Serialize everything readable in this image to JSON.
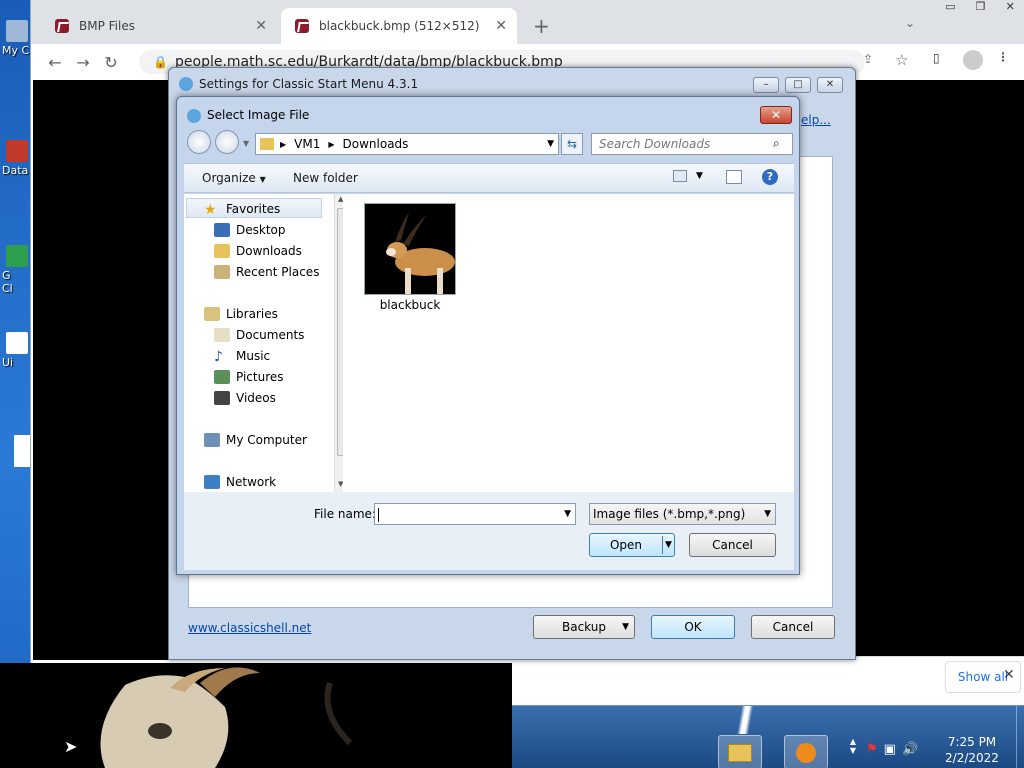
{
  "desktop": {
    "icons": [
      {
        "label": "My C"
      },
      {
        "label": "Data"
      },
      {
        "label": "G"
      },
      {
        "label": "Cl"
      },
      {
        "label": "Ui"
      }
    ]
  },
  "browser": {
    "tabs": [
      {
        "title": "BMP Files"
      },
      {
        "title": "blackbuck.bmp (512×512)"
      }
    ],
    "new_tab": "+",
    "url": "people.math.sc.edu/Burkardt/data/bmp/blackbuck.bmp",
    "help_link": "elp...",
    "download_bar": {
      "show_all": "Show all",
      "close": "✕"
    }
  },
  "classic_window": {
    "title": "Settings for Classic Start Menu 4.3.1",
    "link": "www.classicshell.net",
    "buttons": {
      "backup": "Backup",
      "ok": "OK",
      "cancel": "Cancel"
    }
  },
  "dialog": {
    "title": "Select Image File",
    "breadcrumb": [
      "VM1",
      "Downloads"
    ],
    "search_placeholder": "Search Downloads",
    "commands": {
      "organize": "Organize",
      "new_folder": "New folder"
    },
    "nav": {
      "favorites": {
        "label": "Favorites",
        "items": [
          "Desktop",
          "Downloads",
          "Recent Places"
        ]
      },
      "libraries": {
        "label": "Libraries",
        "items": [
          "Documents",
          "Music",
          "Pictures",
          "Videos"
        ]
      },
      "computer": "My Computer",
      "network": "Network"
    },
    "files": [
      {
        "name": "blackbuck"
      }
    ],
    "file_name_label": "File name:",
    "file_name_value": "",
    "file_type": "Image files (*.bmp,*.png)",
    "buttons": {
      "open": "Open",
      "cancel": "Cancel"
    }
  },
  "taskbar": {
    "time": "7:25 PM",
    "date": "2/2/2022"
  },
  "colors": {
    "titlebar": "#c5d6ec",
    "close_red": "#c8452f",
    "link": "#0645ad",
    "taskbar": "#1b4a85"
  }
}
